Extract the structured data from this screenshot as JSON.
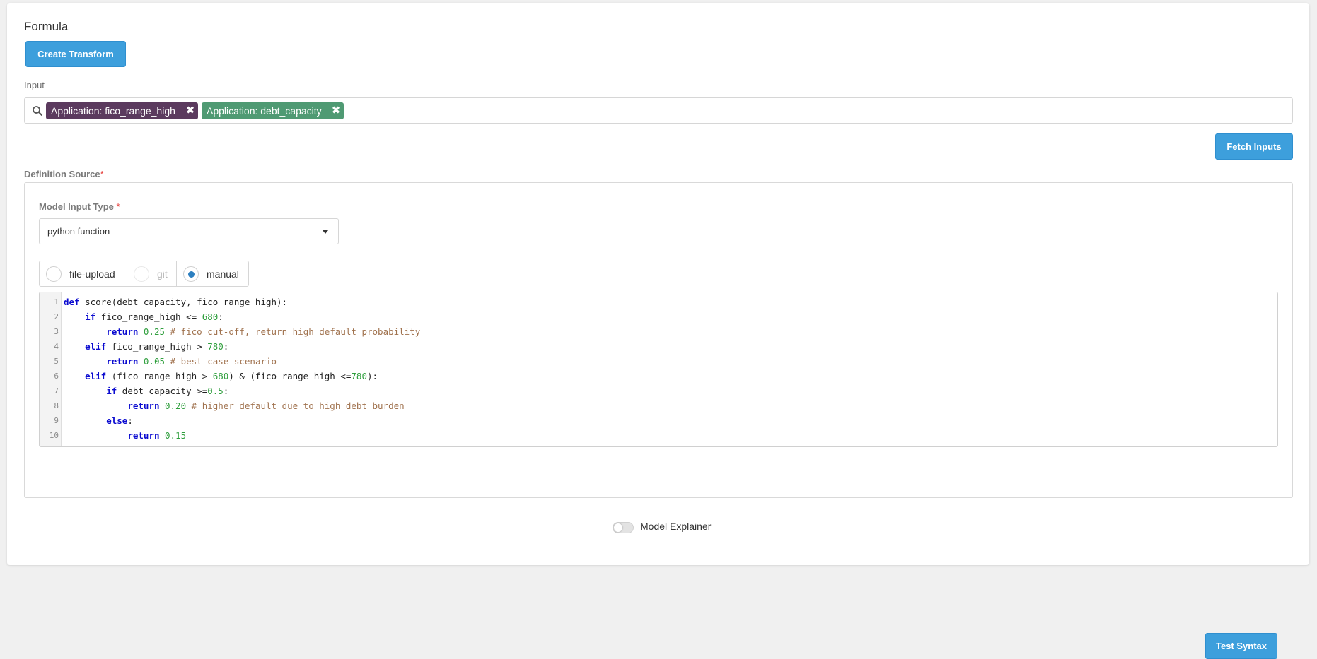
{
  "section_title": "Formula",
  "create_transform_label": "Create Transform",
  "input": {
    "label": "Input",
    "search_icon": "search-icon",
    "chips": [
      {
        "label": "Application: fico_range_high",
        "color": "#5b3a5e"
      },
      {
        "label": "Application: debt_capacity",
        "color": "#4f9a73"
      }
    ],
    "fetch_label": "Fetch Inputs"
  },
  "definition_source": {
    "label": "Definition Source",
    "required_mark": "*",
    "model_input_type": {
      "label": "Model Input Type",
      "required_mark": "*",
      "selected": "python function"
    },
    "source_options": [
      {
        "label": "file-upload",
        "checked": false,
        "disabled": false
      },
      {
        "label": "git",
        "checked": false,
        "disabled": true
      },
      {
        "label": "manual",
        "checked": true,
        "disabled": false
      }
    ],
    "code_lines": [
      "def score(debt_capacity, fico_range_high):",
      "    if fico_range_high <= 680:",
      "        return 0.25 # fico cut-off, return high default probability",
      "    elif fico_range_high > 780:",
      "        return 0.05 # best case scenario",
      "    elif (fico_range_high > 680) & (fico_range_high <=780):",
      "        if debt_capacity >=0.5:",
      "            return 0.20 # higher default due to high debt burden",
      "        else:",
      "            return 0.15"
    ],
    "line_numbers": [
      "1",
      "2",
      "3",
      "4",
      "5",
      "6",
      "7",
      "8",
      "9",
      "10"
    ],
    "test_syntax_label": "Test Syntax"
  },
  "model_explainer": {
    "label": "Model Explainer",
    "enabled": false
  },
  "colors": {
    "primary": "#3d9fdc",
    "required": "#e53935"
  }
}
